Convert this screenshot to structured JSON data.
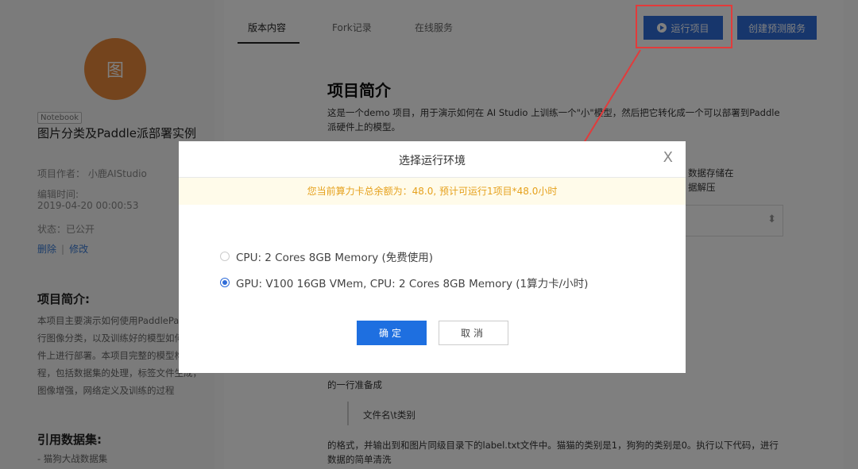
{
  "sidebar": {
    "avatar_text": "图",
    "tag": "Notebook",
    "title": "图片分类及Paddle派部署实例",
    "author": "项目作者： 小鹿AIStudio",
    "edit_label": "编辑时间:",
    "edit_time": "2019-04-20 00:00:53",
    "status": "状态：已公开",
    "delete_label": "删除",
    "modify_label": "修改",
    "intro_heading": "项目简介:",
    "intro_text": "本项目主要演示如何使用PaddlePaddle进行图像分类，以及训练好的模型如何在硬件上进行部署。本项目完整的模型构建过程，包括数据集的处理，标签文件生成，图像增强，网络定义及训练的过程",
    "dataset_heading": "引用数据集:",
    "dataset_item": "- 猫狗大战数据集"
  },
  "tabs": [
    "版本内容",
    "Fork记录",
    "在线服务"
  ],
  "header_buttons": {
    "run": "运行项目",
    "predict": "创建预测服务"
  },
  "content": {
    "title": "项目简介",
    "intro": "这是一个demo 项目，用于演示如何在 AI Studio 上训练一个\"小\"模型，然后把它转化成一个可以部署到Paddle派硬件上的模型。",
    "partial_right_1": "数据存储在",
    "partial_right_2": "据解压",
    "para2": "的一行准备成",
    "code": "文件名\\t类别",
    "para3": "的格式，并输出到和图片同级目录下的label.txt文件中。猫猫的类别是1，狗狗的类别是0。执行以下代码，进行数据的简单清洗"
  },
  "modal": {
    "title": "选择运行环境",
    "close": "X",
    "notice": "您当前算力卡总余额为：48.0, 预计可运行1项目*48.0小时",
    "options": [
      {
        "label": "CPU: 2 Cores 8GB Memory (免费使用)",
        "checked": false
      },
      {
        "label": "GPU: V100 16GB VMem, CPU: 2 Cores 8GB Memory (1算力卡/小时)",
        "checked": true
      }
    ],
    "ok": "确定",
    "cancel": "取消"
  },
  "colors": {
    "primary": "#2f6cd8",
    "annotation_red": "#e23b3b",
    "notice_text": "#e6a11d"
  }
}
